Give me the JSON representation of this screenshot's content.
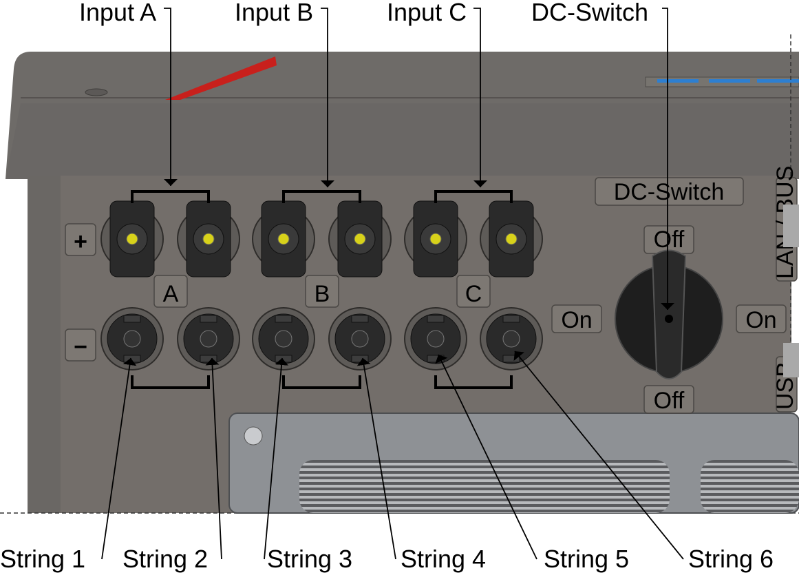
{
  "callouts": {
    "input_a": "Input A",
    "input_b": "Input B",
    "input_c": "Input C",
    "dc_switch": "DC-Switch",
    "strings": [
      "String 1",
      "String 2",
      "String 3",
      "String 4",
      "String 5",
      "String 6"
    ]
  },
  "panel": {
    "plus": "+",
    "minus": "−",
    "group_a": "A",
    "group_b": "B",
    "group_c": "C",
    "dc_switch_label": "DC-Switch",
    "off_top": "Off",
    "off_bottom": "Off",
    "on_left": "On",
    "on_right": "On",
    "lan_bus": "LAN / BUS",
    "usb": "USB"
  },
  "colors": {
    "housing": "#6f6c69",
    "panel": "#736e6a",
    "fan_cover": "#8e9195",
    "accent_red": "#c8201c",
    "connector_tip": "#d8d21a"
  }
}
